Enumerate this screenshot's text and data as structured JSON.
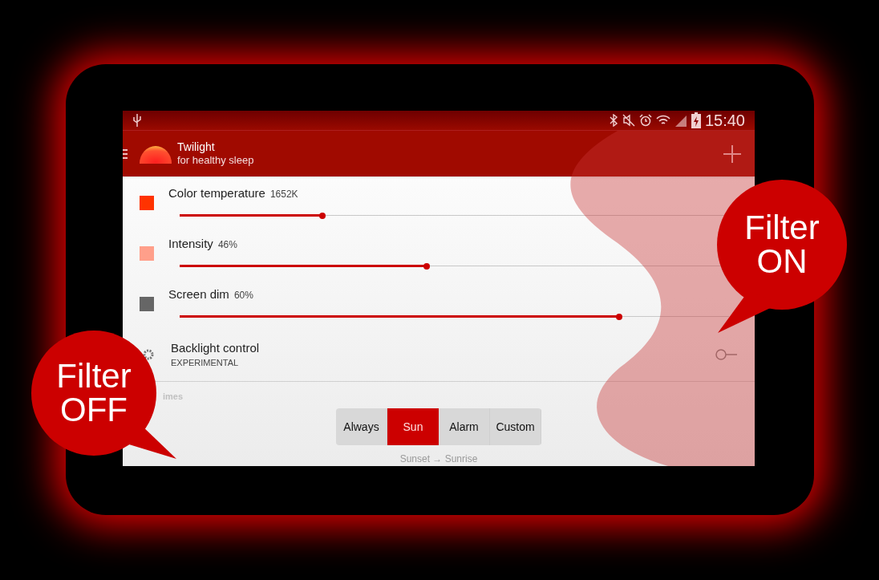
{
  "status_bar": {
    "time": "15:40"
  },
  "app_bar": {
    "title": "Twilight",
    "subtitle": "for healthy sleep"
  },
  "settings": [
    {
      "kind": "slider",
      "label": "Color temperature",
      "reading": "1652K",
      "color": "#ff3300",
      "level": 0.26
    },
    {
      "kind": "slider",
      "label": "Intensity",
      "reading": "46%",
      "color": "#ff9f8a",
      "level": 0.45
    },
    {
      "kind": "slider",
      "label": "Screen dim",
      "reading": "60%",
      "color": "#666666",
      "level": 0.8
    },
    {
      "kind": "switch",
      "label": "Backlight control",
      "sublabel": "EXPERIMENTAL",
      "on": false
    }
  ],
  "section": {
    "title": "imes"
  },
  "modes": [
    {
      "label": "Always",
      "selected": false
    },
    {
      "label": "Sun",
      "selected": true
    },
    {
      "label": "Alarm",
      "selected": false
    },
    {
      "label": "Custom",
      "selected": false
    }
  ],
  "mode_caption": "Sunset → Sunrise",
  "callouts": [
    {
      "lines": [
        "Filter",
        "ON"
      ]
    },
    {
      "lines": [
        "Filter",
        "OFF"
      ]
    }
  ]
}
